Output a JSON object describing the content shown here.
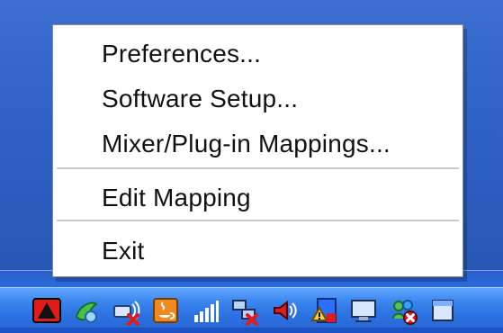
{
  "context_menu": {
    "items": [
      {
        "label": "Preferences..."
      },
      {
        "label": "Software Setup..."
      },
      {
        "label": "Mixer/Plug-in Mappings..."
      },
      {
        "label": "Edit Mapping"
      },
      {
        "label": "Exit"
      }
    ]
  },
  "system_tray": {
    "icons": [
      {
        "name": "alert-red-icon"
      },
      {
        "name": "green-leaf-icon"
      },
      {
        "name": "wireless-network-disconnected-icon"
      },
      {
        "name": "java-coffee-icon"
      },
      {
        "name": "signal-bars-icon"
      },
      {
        "name": "network-disconnected-icon"
      },
      {
        "name": "speaker-volume-icon"
      },
      {
        "name": "security-warning-icon"
      },
      {
        "name": "display-monitor-icon"
      },
      {
        "name": "users-error-icon"
      },
      {
        "name": "window-icon"
      }
    ]
  },
  "colors": {
    "desktop_blue": "#2f63c6",
    "menu_bg": "#ffffff",
    "separator": "#c9c9c9"
  }
}
